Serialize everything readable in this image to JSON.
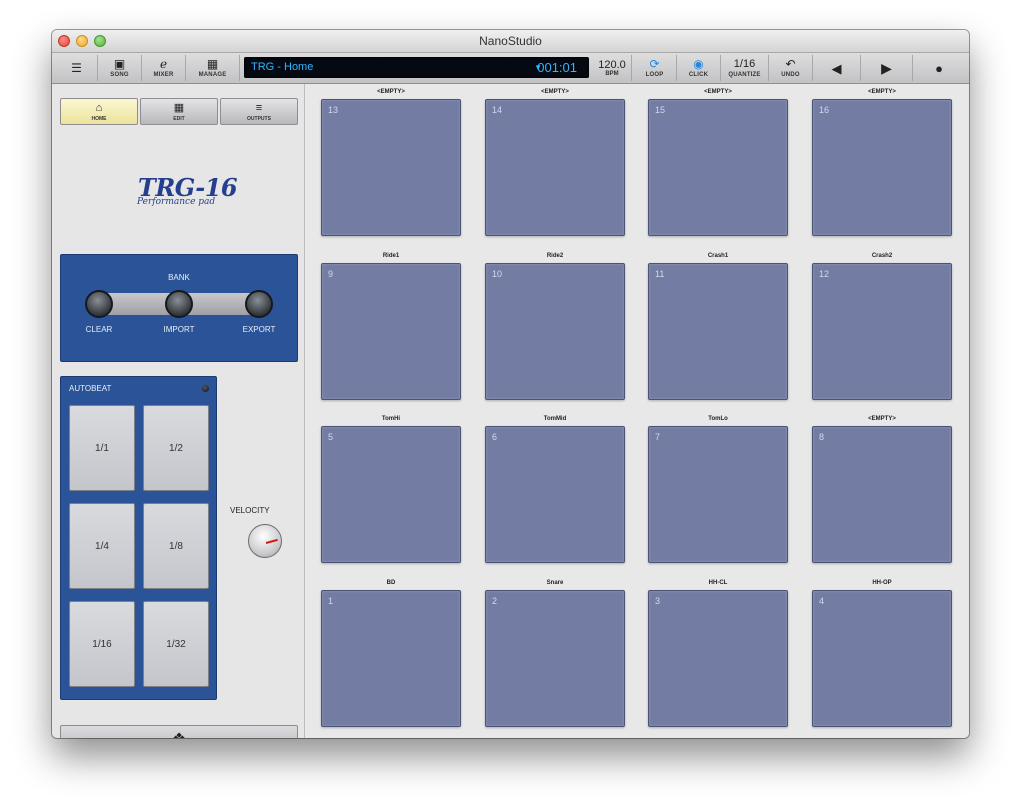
{
  "window": {
    "title": "NanoStudio"
  },
  "toolbar": {
    "menu_icon": "menu-icon",
    "song_label": "SONG",
    "mixer_label": "MIXER",
    "manage_label": "MANAGE",
    "lcd_name": "TRG - Home",
    "lcd_time": "001:01",
    "bpm_value": "120.0",
    "bpm_label": "BPM",
    "loop_label": "LOOP",
    "click_label": "CLICK",
    "quantize_value": "1/16",
    "quantize_label": "QUANTIZE",
    "undo_label": "UNDO",
    "colors": {
      "lcd_text": "#2fb6ff",
      "lcd_bg": "#050a12"
    }
  },
  "sidebar": {
    "tabs": [
      {
        "label": "HOME",
        "icon": "home-icon",
        "active": true
      },
      {
        "label": "EDIT",
        "icon": "grid-icon",
        "active": false
      },
      {
        "label": "OUTPUTS",
        "icon": "sliders-icon",
        "active": false
      }
    ],
    "logo_title": "TRG-16",
    "logo_subtitle": "Performance pad",
    "bank": {
      "title": "BANK",
      "clear": "CLEAR",
      "import": "IMPORT",
      "export": "EXPORT"
    },
    "autobeat": {
      "title": "AUTOBEAT",
      "buttons": [
        "1/1",
        "1/2",
        "1/4",
        "1/8",
        "1/16",
        "1/32"
      ]
    },
    "velocity_label": "VELOCITY",
    "colors": {
      "panel": "#2b5498",
      "pad": "#737da4"
    }
  },
  "pads": [
    {
      "number": "13",
      "label": "<EMPTY>"
    },
    {
      "number": "14",
      "label": "<EMPTY>"
    },
    {
      "number": "15",
      "label": "<EMPTY>"
    },
    {
      "number": "16",
      "label": "<EMPTY>"
    },
    {
      "number": "9",
      "label": "Ride1"
    },
    {
      "number": "10",
      "label": "Ride2"
    },
    {
      "number": "11",
      "label": "Crash1"
    },
    {
      "number": "12",
      "label": "Crash2"
    },
    {
      "number": "5",
      "label": "TomHi"
    },
    {
      "number": "6",
      "label": "TomMid"
    },
    {
      "number": "7",
      "label": "TomLo"
    },
    {
      "number": "8",
      "label": "<EMPTY>"
    },
    {
      "number": "1",
      "label": "BD"
    },
    {
      "number": "2",
      "label": "Snare"
    },
    {
      "number": "3",
      "label": "HH-CL"
    },
    {
      "number": "4",
      "label": "HH-OP"
    }
  ]
}
